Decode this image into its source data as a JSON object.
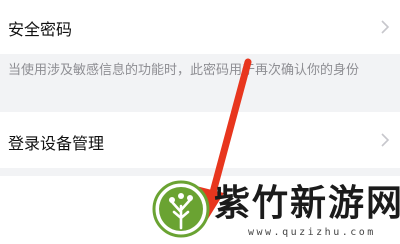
{
  "settings": {
    "rows": [
      {
        "label": "安全密码",
        "icon": "chevron-right-icon"
      },
      {
        "label": "登录设备管理",
        "icon": "chevron-right-icon"
      }
    ],
    "hint": "当使用涉及敏感信息的功能时，此密码用于再次确认你的身份"
  },
  "watermark": {
    "title": "紫竹新游网",
    "url": "www.quzizhu.com"
  },
  "colors": {
    "background": "#f2f3f5",
    "row": "#ffffff",
    "hint_text": "#8e8e93",
    "arrow": "#e8361e",
    "logo_green": "#6aa332"
  }
}
